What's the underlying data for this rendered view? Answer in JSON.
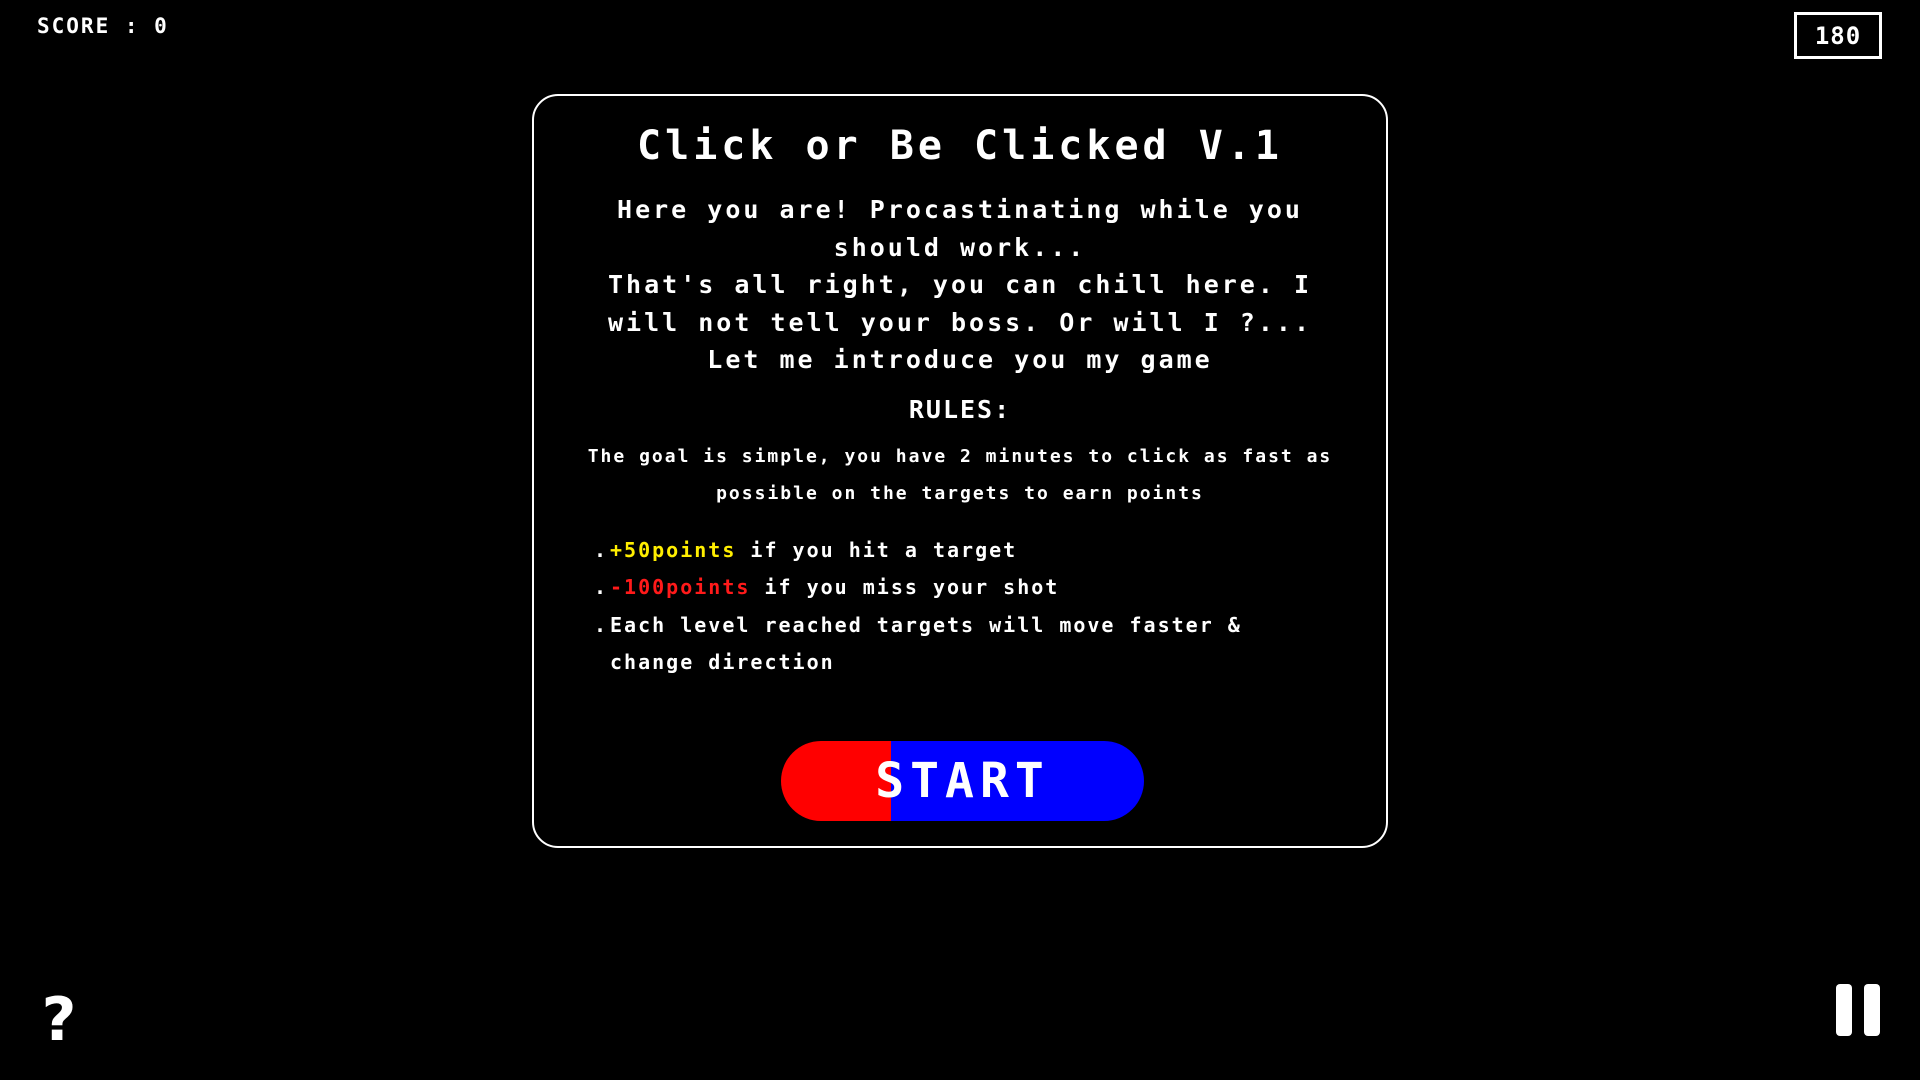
{
  "hud": {
    "score_label": "SCORE : 0",
    "timer": "180"
  },
  "intro_panel": {
    "title": "Click or Be Clicked V.1",
    "intro_line1": "Here you are! Procastinating while you should work...",
    "intro_line2": "That's all right, you can chill here. I will not tell your boss. Or will I ?...",
    "intro_line3": "Let me introduce you my game",
    "rules_heading": "RULES:",
    "goal_text": "The goal is simple, you have 2 minutes to click as fast as possible on the targets to earn points",
    "rules": [
      {
        "highlight": "+50points",
        "text": " if you hit a target"
      },
      {
        "highlight": "-100points",
        "text": " if you miss your shot"
      },
      {
        "text": "Each level reached targets will move faster & change direction"
      }
    ],
    "start_label": "START"
  },
  "controls": {
    "help_label": "?",
    "pause_icon": "pause-icon"
  },
  "colors": {
    "background": "#000000",
    "text": "#ffffff",
    "positive_points": "#ffee00",
    "negative_points": "#ff1a1a",
    "start_left": "#ff0000",
    "start_right": "#0000ff"
  }
}
